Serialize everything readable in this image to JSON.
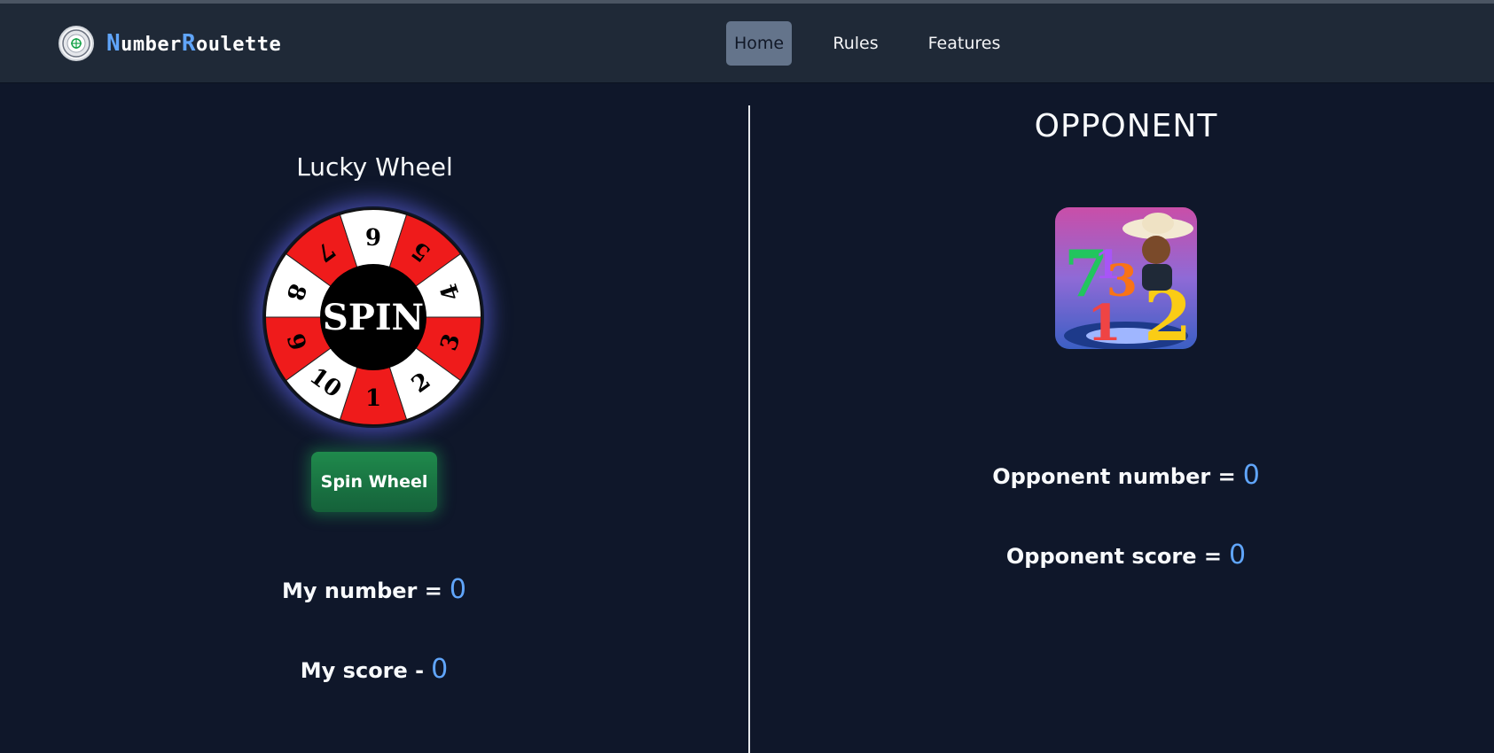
{
  "brand": {
    "letter_n": "N",
    "part_umber": "umber",
    "letter_r": "R",
    "part_oulette": "oulette",
    "accent_color": "#60a5fa"
  },
  "nav": {
    "home": "Home",
    "rules": "Rules",
    "features": "Features",
    "active": "Home"
  },
  "player": {
    "wheel_title": "Lucky Wheel",
    "wheel_center_label": "SPIN",
    "wheel_segments": [
      "6",
      "5",
      "4",
      "3",
      "2",
      "1",
      "10",
      "9",
      "8",
      "7"
    ],
    "spin_button": "Spin Wheel",
    "my_number_label": "My number =",
    "my_number_value": "0",
    "my_score_label": "My score -",
    "my_score_value": "0"
  },
  "opponent": {
    "title": "OPPONENT",
    "number_label": "Opponent number =",
    "number_value": "0",
    "score_label": "Opponent score =",
    "score_value": "0"
  },
  "colors": {
    "background": "#0f172a",
    "navbar": "#1f2937",
    "wheel_red": "#ef1b1b",
    "wheel_white": "#ffffff",
    "spin_button": "#1f8a4c",
    "value_blue": "#60a5fa"
  }
}
